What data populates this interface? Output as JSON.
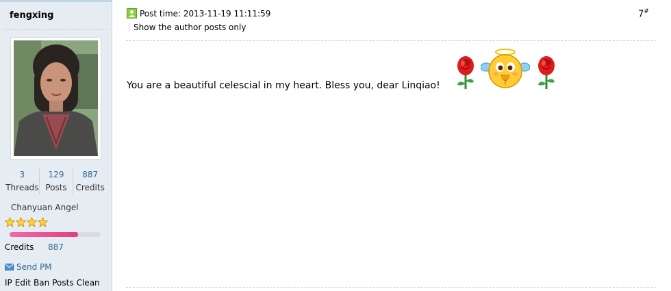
{
  "author": {
    "username": "fengxing",
    "avatar_alt": "",
    "stats": [
      {
        "value": "3",
        "label": "Threads"
      },
      {
        "value": "129",
        "label": "Posts"
      },
      {
        "value": "887",
        "label": "Credits"
      }
    ],
    "group": "Chanyuan Angel",
    "stars": 4,
    "progress_fraction": 0.75,
    "credits_label": "Credits",
    "credits_value": "887",
    "send_pm": "Send PM",
    "admin_links": [
      "IP",
      "Edit",
      "Ban",
      "Posts",
      "Clean"
    ]
  },
  "post": {
    "time_label": "Post time: 2013-11-19 11:11:59",
    "floor_number": "7",
    "floor_suffix": "#",
    "author_only": "Show the author posts only",
    "message": "You are a beautiful celescial in my heart. Bless you, dear Linqiao!",
    "emojis": [
      "rose-icon",
      "angel-smiley-icon",
      "rose-icon"
    ]
  },
  "colors": {
    "sidebar_bg": "#e5edf2",
    "link": "#336699",
    "progress": "#e33d82",
    "border": "#c2d5e3"
  }
}
